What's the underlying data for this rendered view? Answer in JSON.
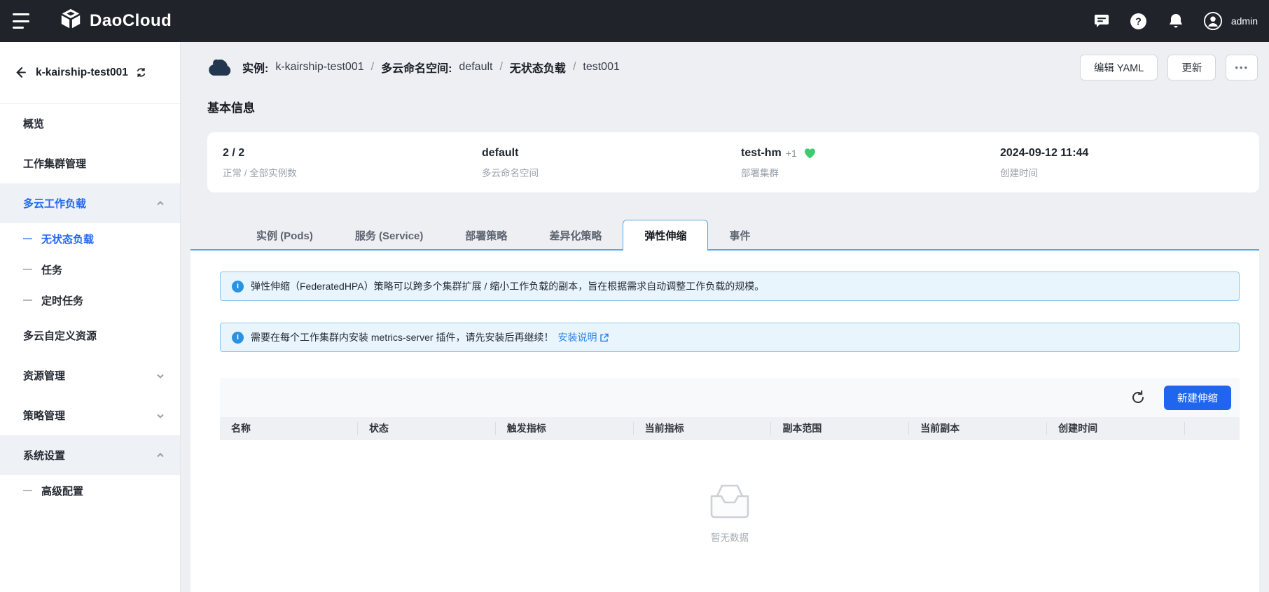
{
  "topbar": {
    "brand": "DaoCloud",
    "user": "admin"
  },
  "sidebar": {
    "title": "k-kairship-test001",
    "items": [
      {
        "label": "概览"
      },
      {
        "label": "工作集群管理"
      },
      {
        "label": "多云工作负载"
      },
      {
        "label": "无状态负载"
      },
      {
        "label": "任务"
      },
      {
        "label": "定时任务"
      },
      {
        "label": "多云自定义资源"
      },
      {
        "label": "资源管理"
      },
      {
        "label": "策略管理"
      },
      {
        "label": "系统设置"
      },
      {
        "label": "高级配置"
      }
    ]
  },
  "breadcrumb": {
    "entity_label": "实例:",
    "entity": "k-kairship-test001",
    "ns_label": "多云命名空间:",
    "ns": "default",
    "kind": "无状态负载",
    "name": "test001",
    "separator": "/"
  },
  "page_actions": {
    "edit_yaml": "编辑 YAML",
    "update": "更新",
    "more": "•••"
  },
  "basic_info": {
    "title": "基本信息",
    "stats": [
      {
        "value": "2 / 2",
        "label": "正常 / 全部实例数"
      },
      {
        "value": "default",
        "label": "多云命名空间"
      },
      {
        "value": "test-hm",
        "suffix": "+1",
        "label": "部署集群"
      },
      {
        "value": "2024-09-12 11:44",
        "label": "创建时间"
      }
    ]
  },
  "tabs": [
    {
      "label": "实例 (Pods)"
    },
    {
      "label": "服务 (Service)"
    },
    {
      "label": "部署策略"
    },
    {
      "label": "差异化策略"
    },
    {
      "label": "弹性伸缩",
      "active": true
    },
    {
      "label": "事件"
    }
  ],
  "alerts": [
    {
      "text": "弹性伸缩（FederatedHPA）策略可以跨多个集群扩展 / 缩小工作负载的副本，旨在根据需求自动调整工作负载的规模。"
    },
    {
      "text": "需要在每个工作集群内安装 metrics-server 插件，请先安装后再继续！",
      "link_text": "安装说明"
    }
  ],
  "table": {
    "create_button": "新建伸缩",
    "columns": [
      "名称",
      "状态",
      "触发指标",
      "当前指标",
      "副本范围",
      "当前副本",
      "创建时间"
    ],
    "empty_text": "暂无数据"
  },
  "colors": {
    "accent": "#2468f2",
    "primary_button": "#2065f0",
    "tab_border": "#56a9e7",
    "alert_bg": "#e9f5fd",
    "alert_border": "#8bc7ef",
    "success_green": "#3ecb6f",
    "topbar_bg": "#20242a"
  }
}
